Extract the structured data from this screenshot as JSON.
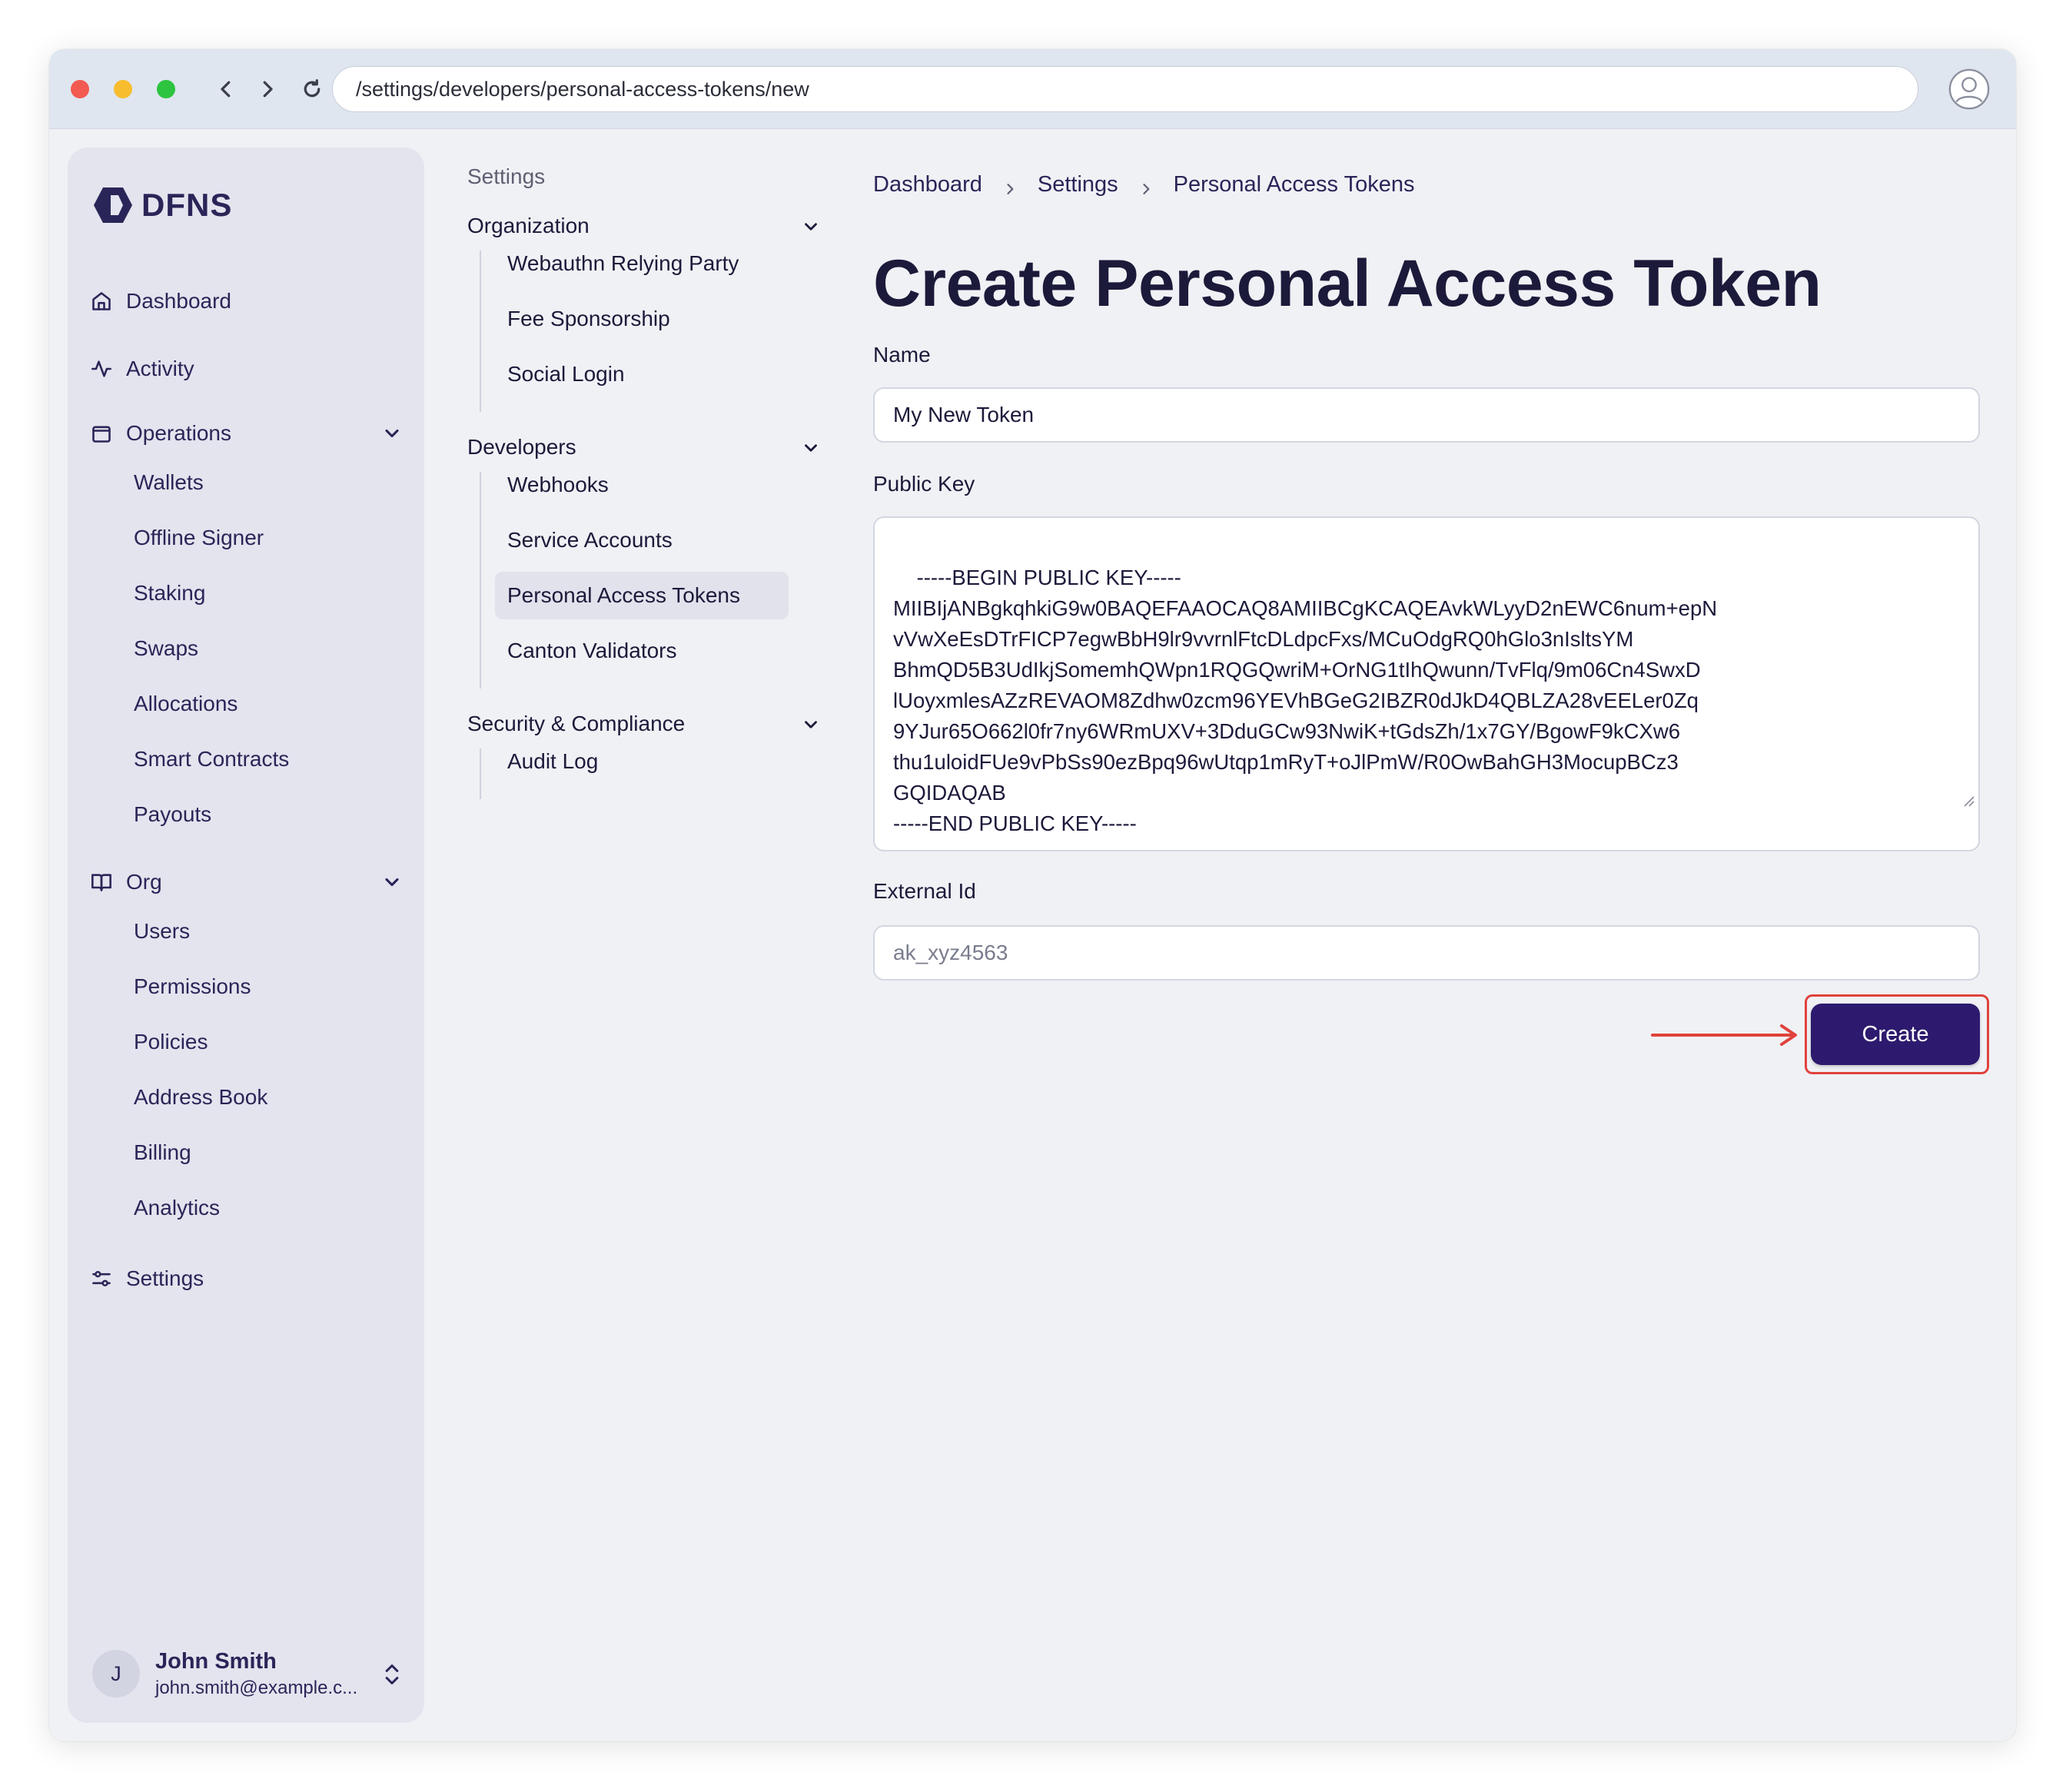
{
  "browser": {
    "url": "/settings/developers/personal-access-tokens/new"
  },
  "sidebar": {
    "logo_text": "DFNS",
    "items": {
      "dashboard": "Dashboard",
      "activity": "Activity",
      "operations": "Operations",
      "org": "Org",
      "settings": "Settings"
    },
    "operations_sub": [
      "Wallets",
      "Offline Signer",
      "Staking",
      "Swaps",
      "Allocations",
      "Smart Contracts",
      "Payouts"
    ],
    "org_sub": [
      "Users",
      "Permissions",
      "Policies",
      "Address Book",
      "Billing",
      "Analytics"
    ],
    "user": {
      "initial": "J",
      "name": "John Smith",
      "email": "john.smith@example.c..."
    }
  },
  "settings_menu": {
    "title": "Settings",
    "groups": {
      "organization": "Organization",
      "developers": "Developers",
      "security": "Security & Compliance"
    },
    "organization_items": [
      "Webauthn Relying Party",
      "Fee Sponsorship",
      "Social Login"
    ],
    "developers_items": [
      "Webhooks",
      "Service Accounts",
      "Personal Access Tokens",
      "Canton Validators"
    ],
    "security_items": [
      "Audit Log"
    ]
  },
  "breadcrumb": [
    "Dashboard",
    "Settings",
    "Personal Access Tokens"
  ],
  "form": {
    "title": "Create Personal Access Token",
    "name_label": "Name",
    "name_value": "My New Token",
    "public_key_label": "Public Key",
    "public_key_value": "-----BEGIN PUBLIC KEY-----\nMIIBIjANBgkqhkiG9w0BAQEFAAOCAQ8AMIIBCgKCAQEAvkWLyyD2nEWC6num+epN\nvVwXeEsDTrFICP7egwBbH9lr9vvrnlFtcDLdpcFxs/MCuOdgRQ0hGlo3nIsltsYM\nBhmQD5B3UdIkjSomemhQWpn1RQGQwriM+OrNG1tIhQwunn/TvFlq/9m06Cn4SwxD\nlUoyxmlesAZzREVAOM8Zdhw0zcm96YEVhBGeG2IBZR0dJkD4QBLZA28vEELer0Zq\n9YJur65O662l0fr7ny6WRmUXV+3DduGCw93NwiK+tGdsZh/1x7GY/BgowF9kCXw6\nthu1uloidFUe9vPbSs90ezBpq96wUtqp1mRyT+oJlPmW/R0OwBahGH3MocupBCz3\nGQIDAQAB\n-----END PUBLIC KEY-----",
    "external_id_label": "External Id",
    "external_id_placeholder": "ak_xyz4563",
    "create_label": "Create"
  },
  "colors": {
    "accent": "#2d1a6e",
    "highlight": "#e0423d"
  }
}
